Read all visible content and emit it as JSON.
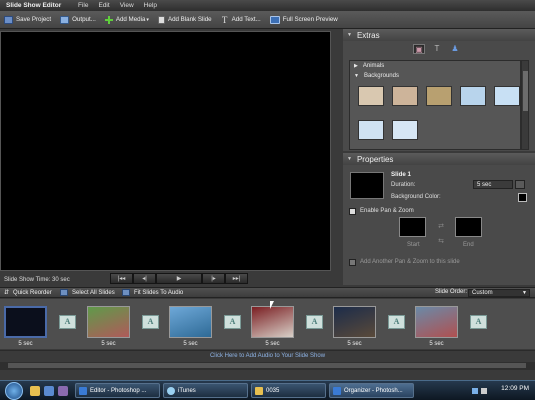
{
  "titlebar": {
    "app_title": "Slide Show Editor",
    "menu": [
      "File",
      "Edit",
      "View",
      "Help"
    ]
  },
  "toolbar": {
    "save_project": "Save Project",
    "output": "Output...",
    "add_media": "Add Media",
    "add_blank_slide": "Add Blank Slide",
    "add_text": "Add Text...",
    "full_screen_preview": "Full Screen Preview"
  },
  "preview": {
    "show_time": "Slide Show Time: 30 sec"
  },
  "extras": {
    "title": "Extras",
    "categories": [
      "Animals",
      "Backgrounds"
    ],
    "backgrounds": [
      {
        "color": "#d9c8b0"
      },
      {
        "color": "#cdb49a"
      },
      {
        "color": "#b8a070"
      },
      {
        "color": "#b8d4ec"
      },
      {
        "color": "#c8e0f4"
      },
      {
        "color": "#cfe2f2"
      },
      {
        "color": "#d6e6f4"
      }
    ]
  },
  "properties": {
    "title": "Properties",
    "slide_name": "Slide 1",
    "duration_label": "Duration:",
    "duration_value": "5 sec",
    "background_color_label": "Background Color:",
    "enable_pan_zoom": "Enable Pan & Zoom",
    "start_label": "Start",
    "end_label": "End",
    "add_pan_zoom": "Add Another Pan & Zoom to this slide"
  },
  "strip_bar": {
    "quick_reorder": "Quick Reorder",
    "select_all": "Select All Slides",
    "fit_to_audio": "Fit Slides To Audio",
    "slide_order_label": "Slide Order:",
    "slide_order_value": "Custom"
  },
  "slides": [
    {
      "duration": "5 sec",
      "colors": [
        "#0b0f1c",
        "#0b0f1c"
      ]
    },
    {
      "duration": "5 sec",
      "colors": [
        "#5f9a4a",
        "#b05a5a"
      ]
    },
    {
      "duration": "5 sec",
      "colors": [
        "#6ea8d8",
        "#2e6a96"
      ]
    },
    {
      "duration": "5 sec",
      "colors": [
        "#7a1e22",
        "#d8d0c8"
      ]
    },
    {
      "duration": "5 sec",
      "colors": [
        "#1c2c4a",
        "#5a4a3a"
      ]
    },
    {
      "duration": "5 sec",
      "colors": [
        "#6a8aa8",
        "#b05050"
      ]
    }
  ],
  "transition_glyph": "A",
  "audio_bar": {
    "text": "Click Here to Add Audio to Your Slide Show"
  },
  "taskbar": {
    "items": [
      {
        "label": "Editor - Photoshop ...",
        "icon_color": "#3a7bd5"
      },
      {
        "label": "iTunes",
        "icon_color": "#9ad0f0"
      },
      {
        "label": "0035",
        "icon_color": "#e8c050"
      },
      {
        "label": "Organizer - Photosh...",
        "icon_color": "#3a7bd5"
      }
    ],
    "clock": "12:09 PM"
  }
}
